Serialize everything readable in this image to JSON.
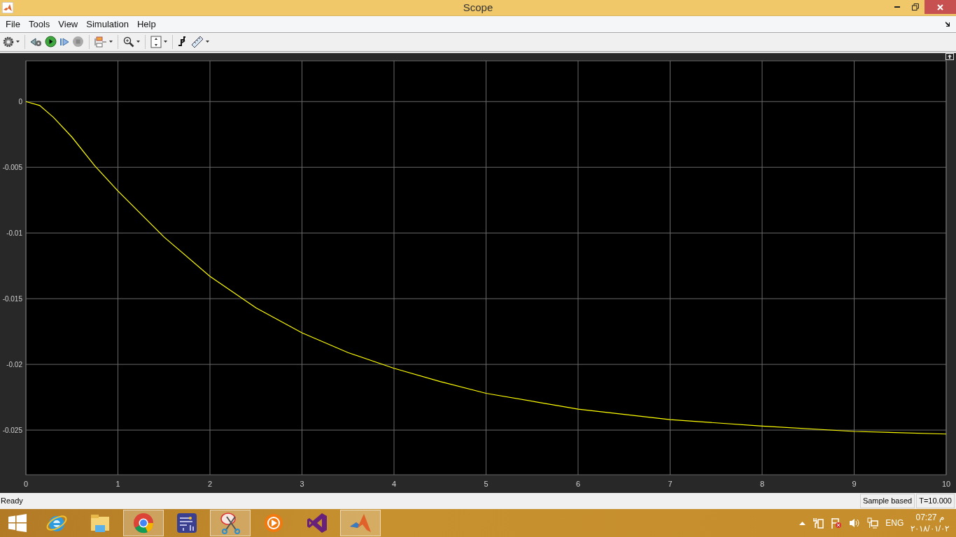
{
  "window": {
    "title": "Scope"
  },
  "menu": [
    "File",
    "Tools",
    "View",
    "Simulation",
    "Help"
  ],
  "plot": {
    "chart_data": {
      "type": "line",
      "x": [
        0,
        0.15,
        0.3,
        0.5,
        0.75,
        1,
        1.5,
        2,
        2.5,
        3,
        3.5,
        4,
        4.5,
        5,
        6,
        7,
        8,
        9,
        10
      ],
      "grid": true,
      "series": [
        {
          "color": "#ffff00",
          "values": [
            0,
            -0.0003,
            -0.0012,
            -0.0027,
            -0.0049,
            -0.0068,
            -0.0103,
            -0.0133,
            -0.0157,
            -0.0176,
            -0.0191,
            -0.0203,
            -0.0213,
            -0.0222,
            -0.0234,
            -0.0242,
            -0.0247,
            -0.0251,
            -0.0253
          ]
        }
      ],
      "xlim": [
        0,
        10
      ],
      "ylim": [
        -0.0284,
        0.0031
      ],
      "xticks": [
        0,
        1,
        2,
        3,
        4,
        5,
        6,
        7,
        8,
        9,
        10
      ],
      "yticks": [
        {
          "value": 0,
          "label": "0"
        },
        {
          "value": -0.005,
          "label": "-0.005"
        },
        {
          "value": -0.01,
          "label": "-0.01"
        },
        {
          "value": -0.015,
          "label": "-0.015"
        },
        {
          "value": -0.02,
          "label": "-0.02"
        },
        {
          "value": -0.025,
          "label": "-0.025"
        }
      ]
    }
  },
  "status_bar": {
    "status": "Ready",
    "mode": "Sample based",
    "time": "T=10.000"
  },
  "taskbar": {
    "apps": [
      {
        "kind": "ie",
        "running": false
      },
      {
        "kind": "explorer",
        "running": false
      },
      {
        "kind": "chrome",
        "running": true
      },
      {
        "kind": "circuit",
        "running": false
      },
      {
        "kind": "snip",
        "running": true
      },
      {
        "kind": "media",
        "running": false
      },
      {
        "kind": "studio",
        "running": false
      },
      {
        "kind": "matlab",
        "running": true
      }
    ],
    "language": "ENG",
    "clock": "07:27 م",
    "date": "٢٠١٨/٠١/٠٢"
  }
}
